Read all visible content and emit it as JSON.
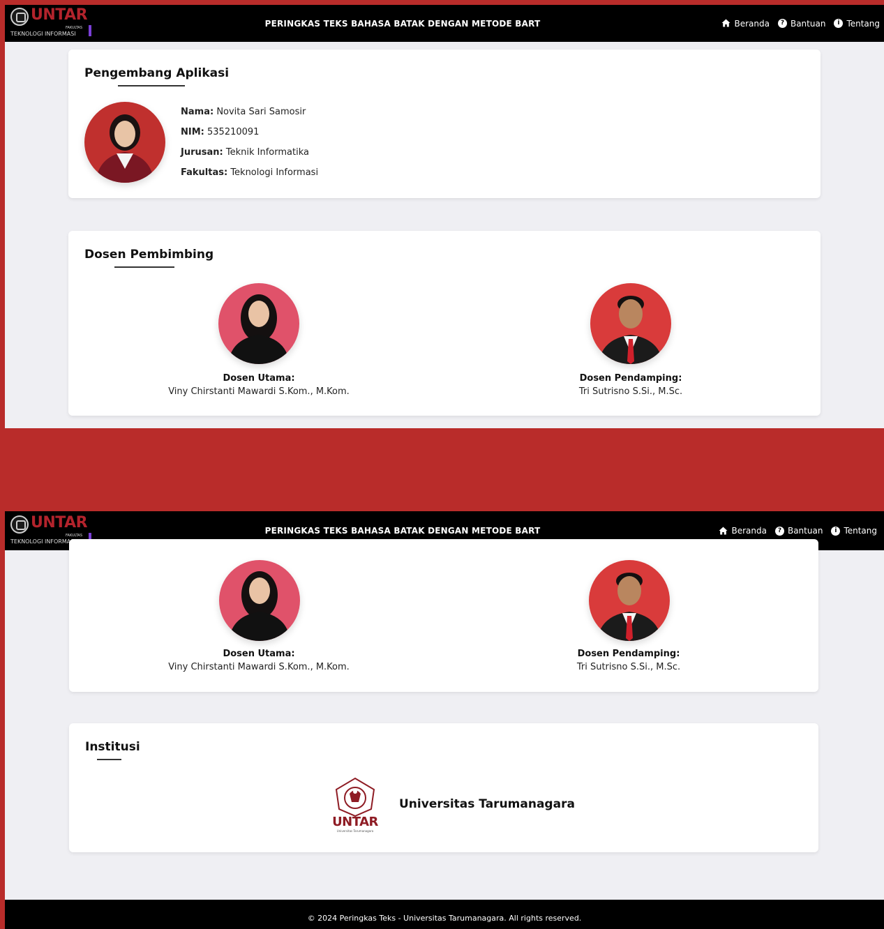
{
  "navbar": {
    "brand_name": "UNTAR",
    "brand_small": "FAKULTAS",
    "brand_sub": "TEKNOLOGI INFORMASI",
    "title": "PERINGKAS TEKS BAHASA BATAK DENGAN METODE BART",
    "links": [
      {
        "label": "Beranda",
        "icon": "home-icon"
      },
      {
        "label": "Bantuan",
        "icon": "help-icon"
      },
      {
        "label": "Tentang",
        "icon": "info-icon"
      }
    ]
  },
  "developer": {
    "title": "Pengembang Aplikasi",
    "fields": [
      {
        "label": "Nama:",
        "value": "Novita Sari Samosir"
      },
      {
        "label": "NIM:",
        "value": "535210091"
      },
      {
        "label": "Jurusan:",
        "value": "Teknik Informatika"
      },
      {
        "label": "Fakultas:",
        "value": "Teknologi Informasi"
      }
    ]
  },
  "supervisors": {
    "title": "Dosen Pembimbing",
    "main": {
      "role": "Dosen Utama:",
      "name": "Viny Chirstanti Mawardi S.Kom., M.Kom."
    },
    "assistant": {
      "role": "Dosen Pendamping:",
      "name": "Tri Sutrisno S.Si., M.Sc."
    }
  },
  "institution": {
    "title": "Institusi",
    "logo_text": "UNTAR",
    "logo_sub": "Universitas Tarumanagara",
    "name": "Universitas Tarumanagara"
  },
  "footer": {
    "text": "© 2024 Peringkas Teks - Universitas Tarumanagara. All rights reserved."
  },
  "colors": {
    "frame": "#b92c2a",
    "navbar": "#000000",
    "page_bg": "#efeff3",
    "brand": "#b3232c"
  }
}
